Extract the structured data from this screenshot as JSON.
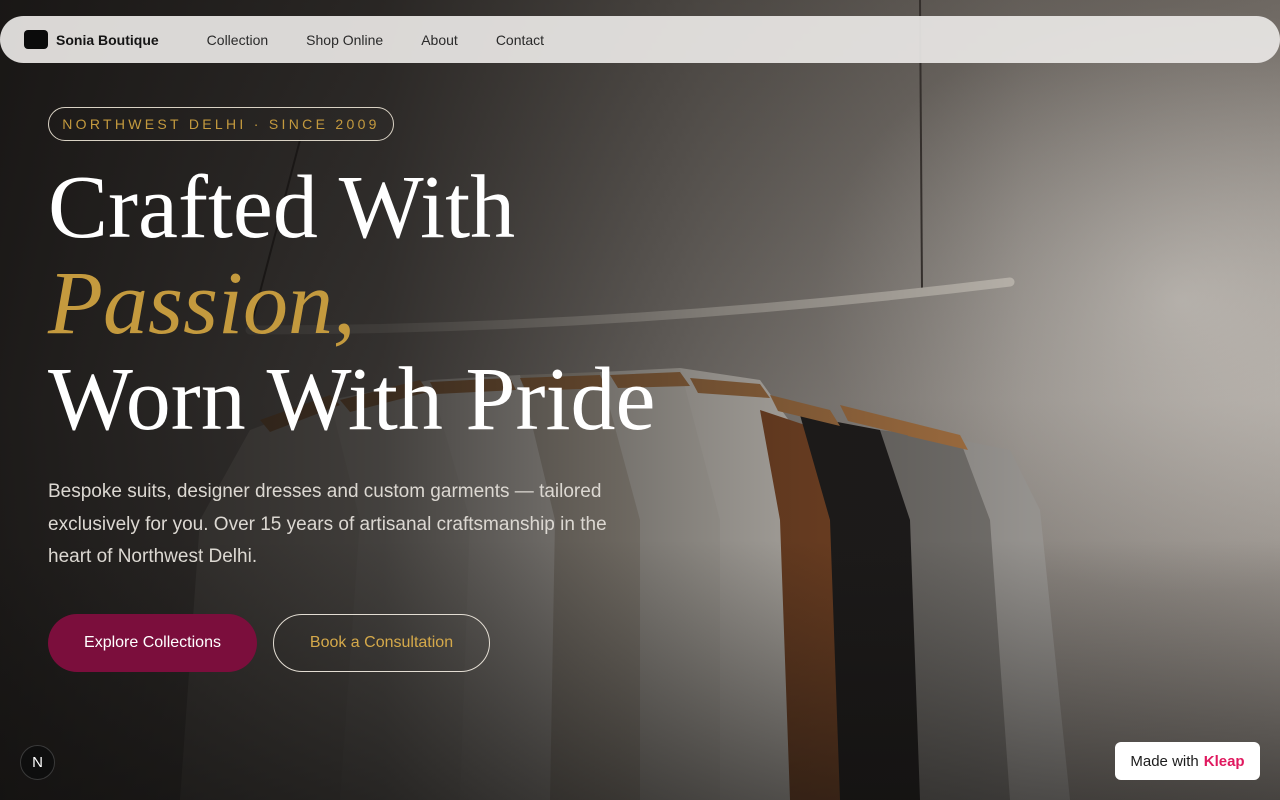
{
  "nav": {
    "brand": "Sonia Boutique",
    "links": [
      "Collection",
      "Shop Online",
      "About",
      "Contact"
    ]
  },
  "hero": {
    "eyebrow": "NORTHWEST DELHI · SINCE 2009",
    "headline_line1": "Crafted With",
    "headline_accent": "Passion,",
    "headline_line3": "Worn With Pride",
    "subtext": "Bespoke suits, designer dresses and custom garments — tailored exclusively for you. Over 15 years of artisanal craftsmanship in the heart of Northwest Delhi.",
    "primary_cta": "Explore Collections",
    "secondary_cta": "Book a Consultation"
  },
  "badges": {
    "n_letter": "N",
    "made_with": "Made with",
    "made_with_brand": "Kleap"
  },
  "colors": {
    "accent_gold": "#c49a3e",
    "primary_button": "#7b0e3c",
    "kleap_pink": "#e0195f"
  },
  "icons": [
    "brand-logo-icon",
    "n-badge-icon"
  ]
}
